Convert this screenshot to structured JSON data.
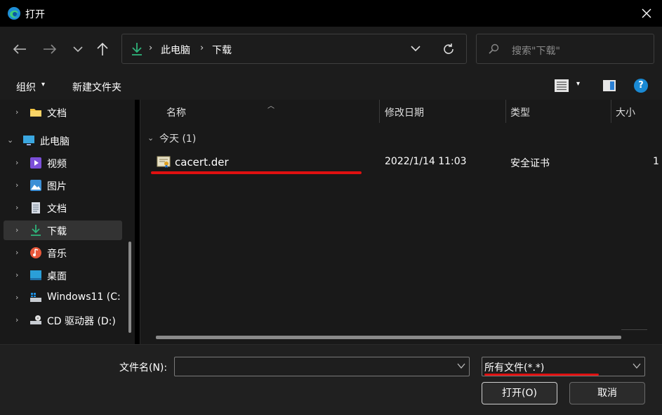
{
  "window": {
    "title": "打开"
  },
  "address": {
    "crumbs": [
      "此电脑",
      "下载"
    ]
  },
  "search": {
    "placeholder": "搜索\"下载\""
  },
  "toolbar": {
    "organize": "组织",
    "new_folder": "新建文件夹"
  },
  "sidebar": {
    "items": [
      {
        "label": "文档",
        "icon": "folder-icon"
      },
      {
        "label": "此电脑",
        "icon": "pc-icon"
      },
      {
        "label": "视频",
        "icon": "video-icon"
      },
      {
        "label": "图片",
        "icon": "picture-icon"
      },
      {
        "label": "文档",
        "icon": "document-icon"
      },
      {
        "label": "下载",
        "icon": "download-icon"
      },
      {
        "label": "音乐",
        "icon": "music-icon"
      },
      {
        "label": "桌面",
        "icon": "desktop-icon"
      },
      {
        "label": "Windows11 (C:",
        "icon": "drive-icon"
      },
      {
        "label": "CD 驱动器 (D:)",
        "icon": "cd-drive-icon"
      }
    ]
  },
  "columns": {
    "name": "名称",
    "date": "修改日期",
    "type": "类型",
    "size": "大小"
  },
  "group": {
    "label": "今天 (1)"
  },
  "files": [
    {
      "name": "cacert.der",
      "date": "2022/1/14 11:03",
      "type": "安全证书",
      "size": "1"
    }
  ],
  "bottom": {
    "filename_label": "文件名(N):",
    "filename_value": "",
    "filetype_value": "所有文件(*.*)",
    "open_label": "打开(O)",
    "cancel_label": "取消"
  },
  "colors": {
    "accent": "#1a8ad4",
    "annotation": "#e01010",
    "download_green": "#2fb37a"
  }
}
